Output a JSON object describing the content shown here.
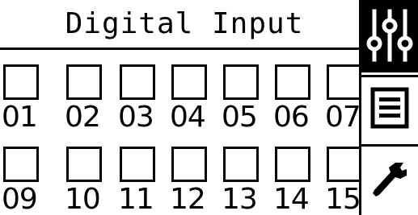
{
  "header": {
    "title": "Digital Input"
  },
  "inputs": {
    "row1": [
      {
        "label": "01",
        "checked": false
      },
      {
        "label": "02",
        "checked": false
      },
      {
        "label": "03",
        "checked": false
      },
      {
        "label": "04",
        "checked": false
      },
      {
        "label": "05",
        "checked": false
      },
      {
        "label": "06",
        "checked": false
      },
      {
        "label": "07",
        "checked": false
      }
    ],
    "row2": [
      {
        "label": "09",
        "checked": false
      },
      {
        "label": "10",
        "checked": false
      },
      {
        "label": "11",
        "checked": false
      },
      {
        "label": "12",
        "checked": false
      },
      {
        "label": "13",
        "checked": false
      },
      {
        "label": "14",
        "checked": false
      },
      {
        "label": "15",
        "checked": false
      }
    ]
  },
  "sidebar": {
    "items": [
      {
        "icon": "sliders-icon",
        "active": true
      },
      {
        "icon": "list-icon",
        "active": false
      },
      {
        "icon": "wrench-icon",
        "active": false
      }
    ]
  },
  "colors": {
    "foreground": "#000000",
    "background": "#ffffff"
  }
}
